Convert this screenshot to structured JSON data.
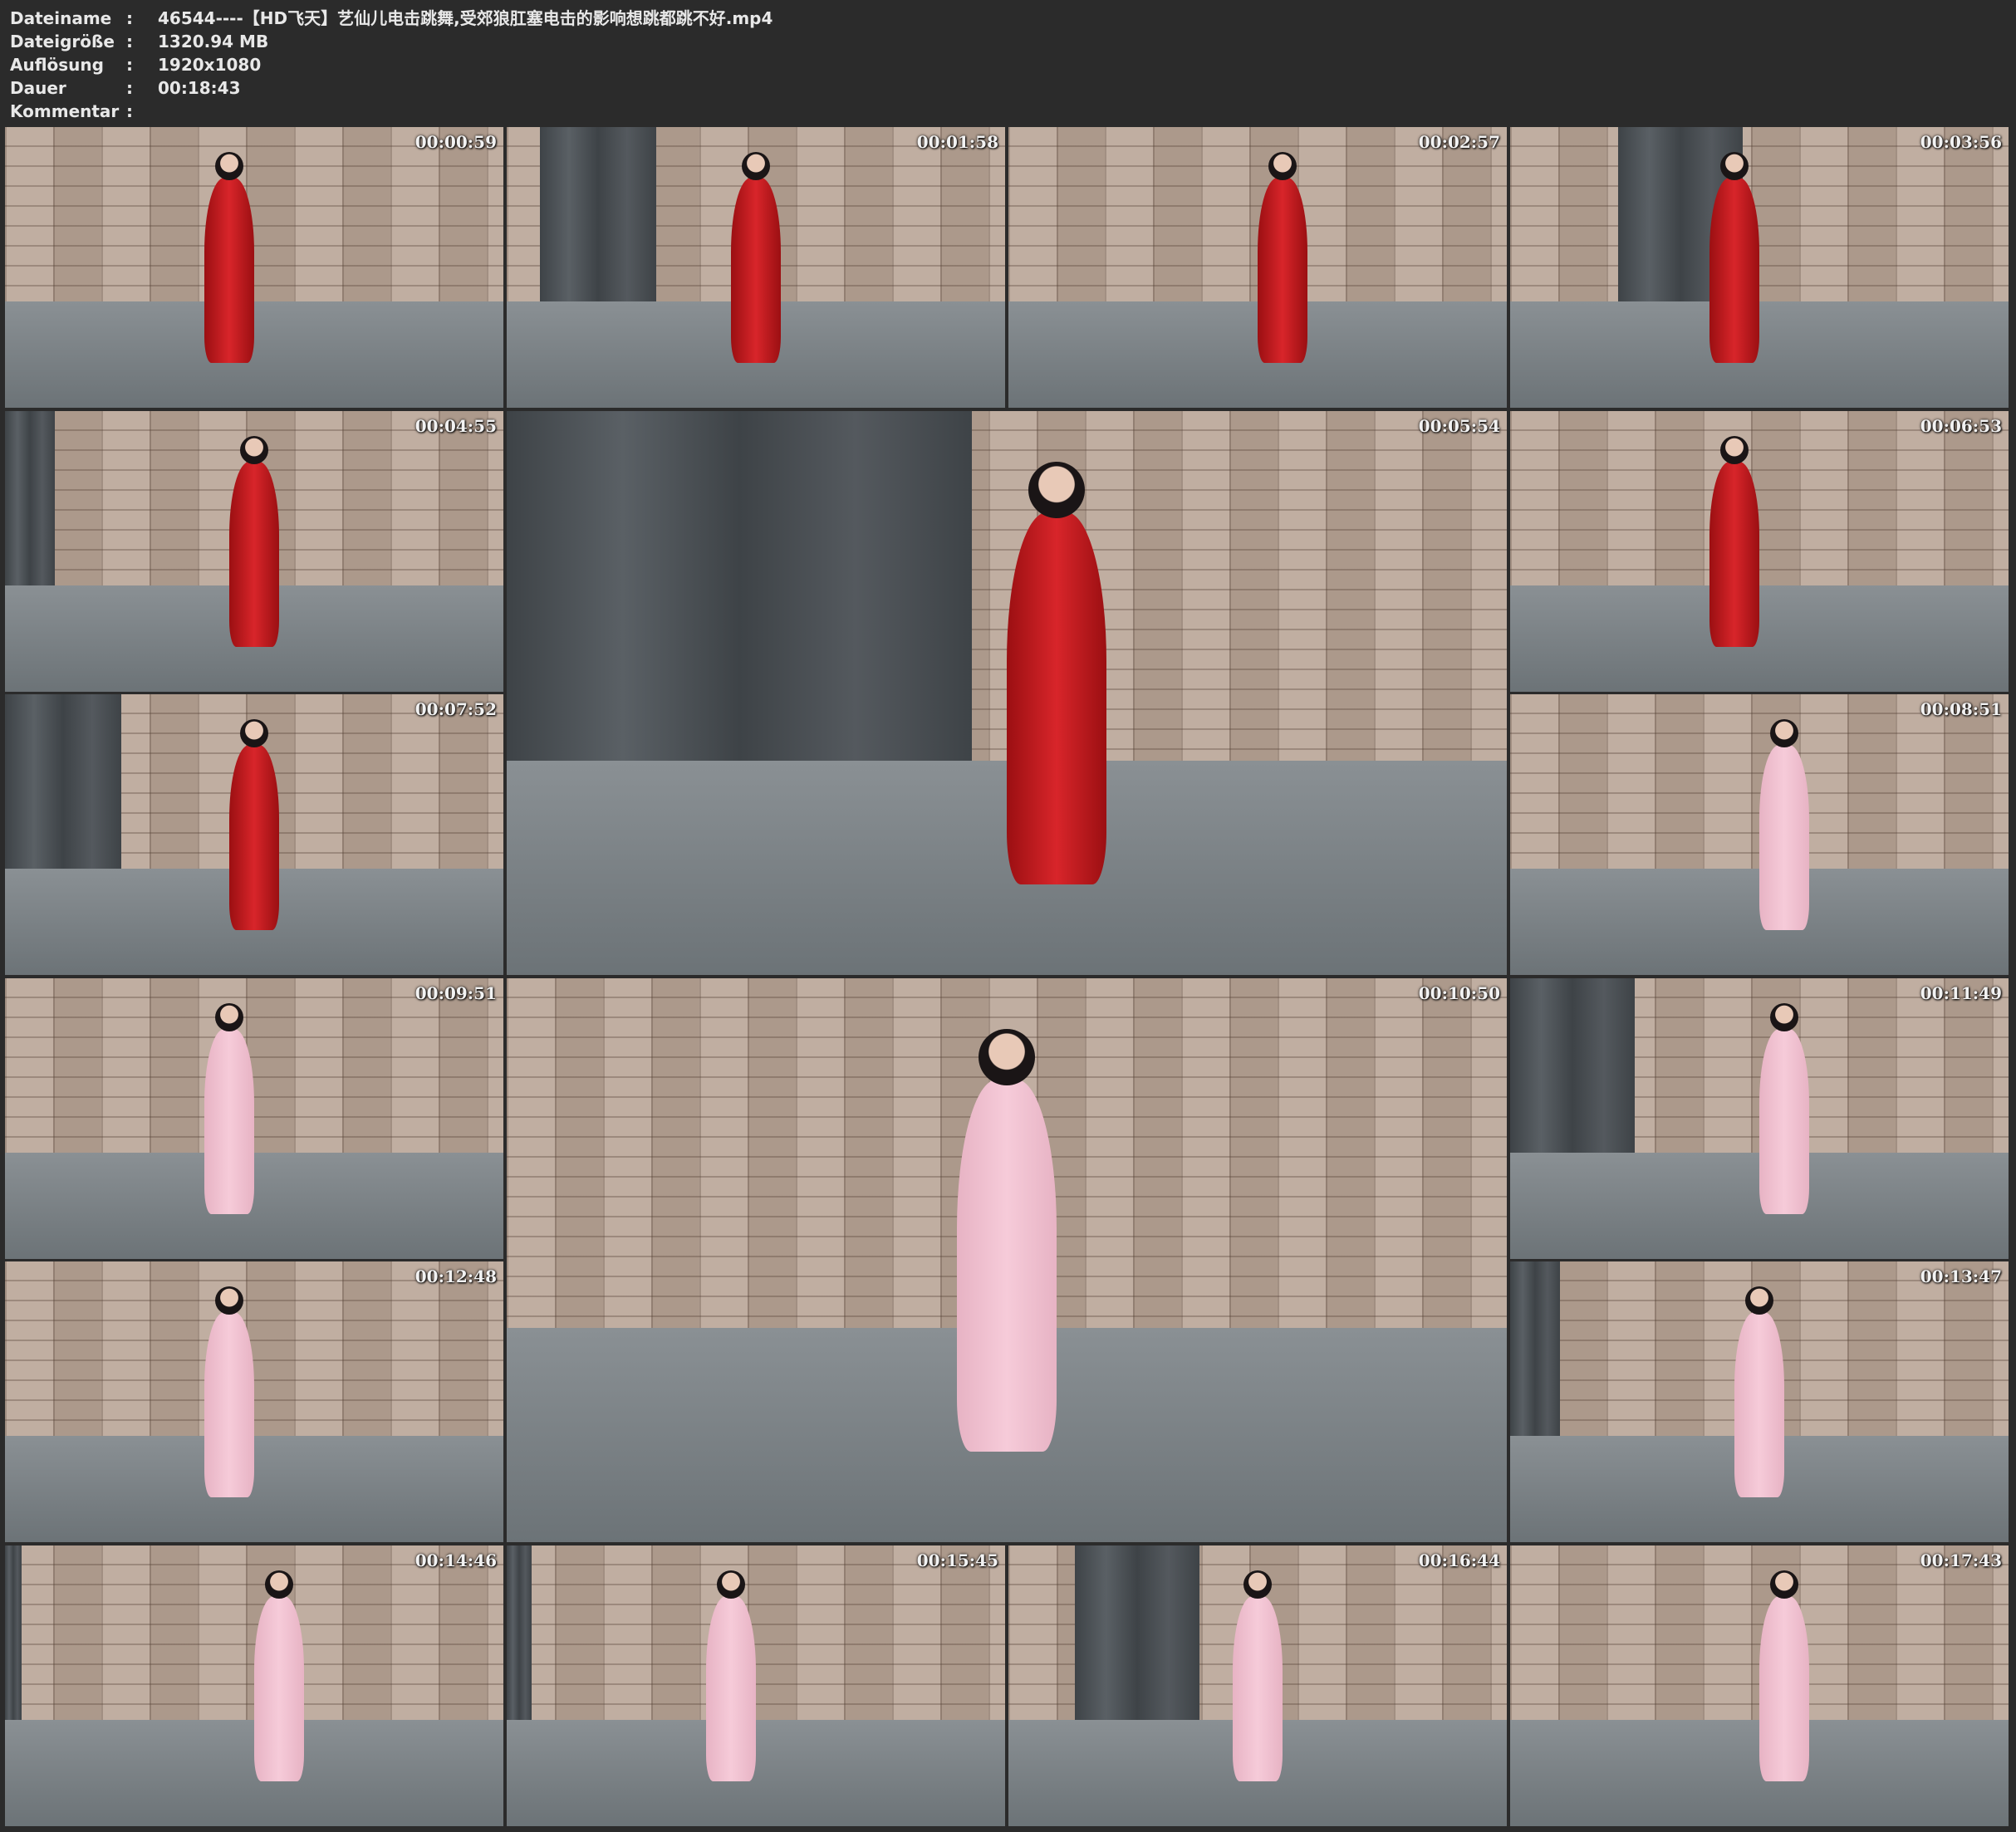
{
  "meta": [
    {
      "key": "Dateiname",
      "value": "46544----【HD飞天】艺仙儿电击跳舞,受郊狼肛塞电击的影响想跳都跳不好.mp4"
    },
    {
      "key": "Dateigröße",
      "value": "1320.94 MB"
    },
    {
      "key": "Auflösung",
      "value": "1920x1080"
    },
    {
      "key": "Dauer",
      "value": "00:18:43"
    },
    {
      "key": "Kommentar",
      "value": ""
    }
  ],
  "separator": ":",
  "thumbnails": [
    {
      "timestamp": "00:00:59",
      "outfit": "red"
    },
    {
      "timestamp": "00:01:58",
      "outfit": "red"
    },
    {
      "timestamp": "00:02:57",
      "outfit": "red"
    },
    {
      "timestamp": "00:03:56",
      "outfit": "red"
    },
    {
      "timestamp": "00:04:55",
      "outfit": "red"
    },
    {
      "timestamp": "00:05:54",
      "outfit": "red"
    },
    {
      "timestamp": "00:06:53",
      "outfit": "red"
    },
    {
      "timestamp": "00:07:52",
      "outfit": "red"
    },
    {
      "timestamp": "00:08:51",
      "outfit": "pink"
    },
    {
      "timestamp": "00:09:51",
      "outfit": "pink"
    },
    {
      "timestamp": "00:10:50",
      "outfit": "pink"
    },
    {
      "timestamp": "00:11:49",
      "outfit": "pink"
    },
    {
      "timestamp": "00:12:48",
      "outfit": "pink"
    },
    {
      "timestamp": "00:13:47",
      "outfit": "pink"
    },
    {
      "timestamp": "00:14:46",
      "outfit": "pink"
    },
    {
      "timestamp": "00:15:45",
      "outfit": "pink"
    },
    {
      "timestamp": "00:16:44",
      "outfit": "pink"
    },
    {
      "timestamp": "00:17:43",
      "outfit": "pink"
    }
  ]
}
